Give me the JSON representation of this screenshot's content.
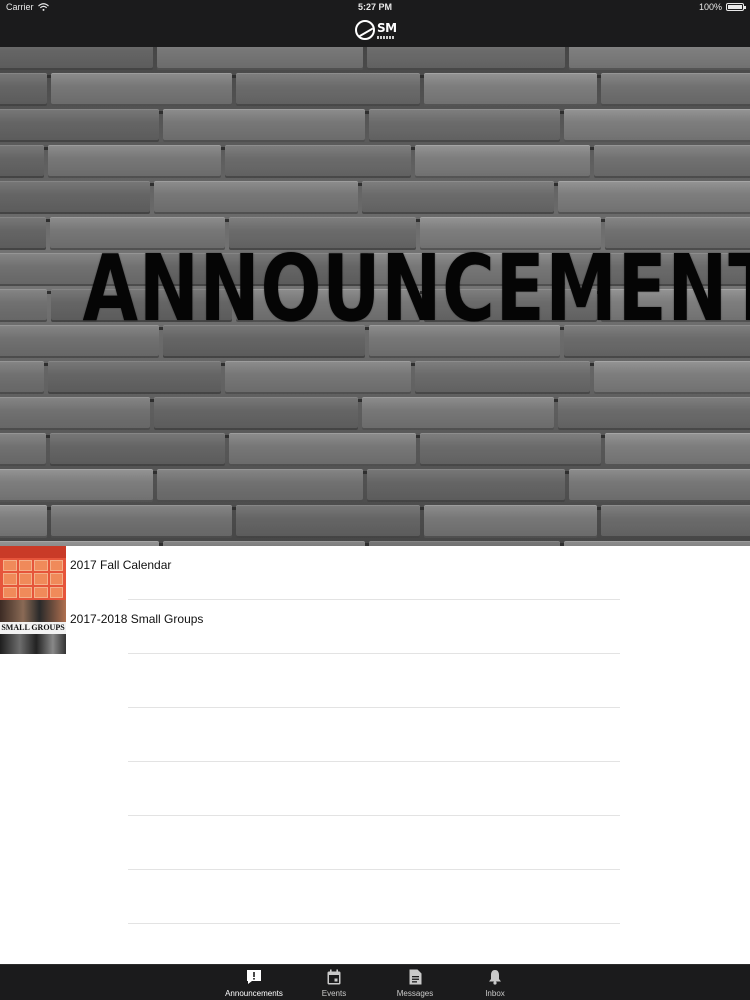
{
  "status_bar": {
    "carrier": "Carrier",
    "time": "5:27 PM",
    "battery_text": "100%",
    "battery_level": 1.0
  },
  "nav": {
    "logo_text": "SM"
  },
  "hero": {
    "title": "ANNOUNCEMENTS"
  },
  "list": {
    "items": [
      {
        "label": "2017 Fall Calendar",
        "thumb": "calendar"
      },
      {
        "label": "2017-2018 Small Groups",
        "thumb": "small-groups",
        "thumb_text": "SMALL GROUPS"
      }
    ]
  },
  "tabs": [
    {
      "label": "Announcements",
      "icon": "announcement-icon",
      "active": true
    },
    {
      "label": "Events",
      "icon": "calendar-icon",
      "active": false
    },
    {
      "label": "Messages",
      "icon": "document-icon",
      "active": false
    },
    {
      "label": "Inbox",
      "icon": "bell-icon",
      "active": false
    }
  ],
  "colors": {
    "bar_background": "#1b1b1c",
    "tab_active": "#ffffff",
    "tab_inactive": "#c9c9c9"
  }
}
